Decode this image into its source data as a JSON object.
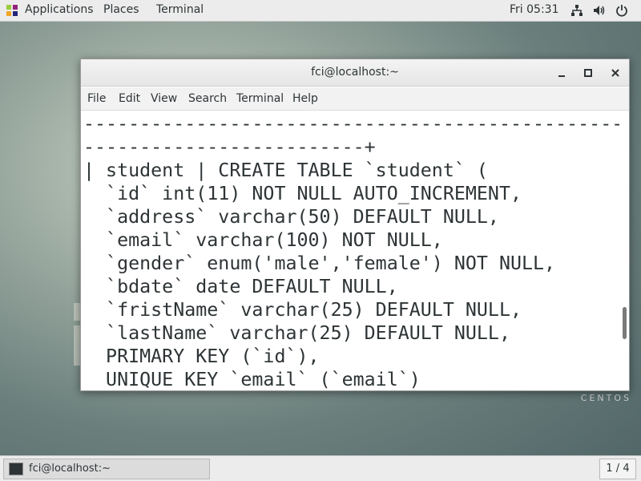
{
  "top_bar": {
    "applications": "Applications",
    "places": "Places",
    "terminal": "Terminal",
    "clock": "Fri 05:31",
    "icons": [
      "applications-icon",
      "network-icon",
      "volume-icon",
      "power-icon"
    ]
  },
  "window": {
    "title": "fci@localhost:~",
    "controls": [
      "minimize-icon",
      "maximize-icon",
      "close-icon"
    ],
    "menu": [
      "File",
      "Edit",
      "View",
      "Search",
      "Terminal",
      "Help"
    ]
  },
  "terminal": {
    "lines": [
      "--------------------------------------------------------",
      "-------------------------+",
      "| student | CREATE TABLE `student` (",
      "  `id` int(11) NOT NULL AUTO_INCREMENT,",
      "  `address` varchar(50) DEFAULT NULL,",
      "  `email` varchar(100) NOT NULL,",
      "  `gender` enum('male','female') NOT NULL,",
      "  `bdate` date DEFAULT NULL,",
      "  `fristName` varchar(25) DEFAULT NULL,",
      "  `lastName` varchar(25) DEFAULT NULL,",
      "  PRIMARY KEY (`id`),",
      "  UNIQUE KEY `email` (`email`)"
    ]
  },
  "desktop": {
    "watermark": "CENTOS"
  },
  "taskbar": {
    "task_label": "fci@localhost:~",
    "workspace": "1 / 4"
  }
}
